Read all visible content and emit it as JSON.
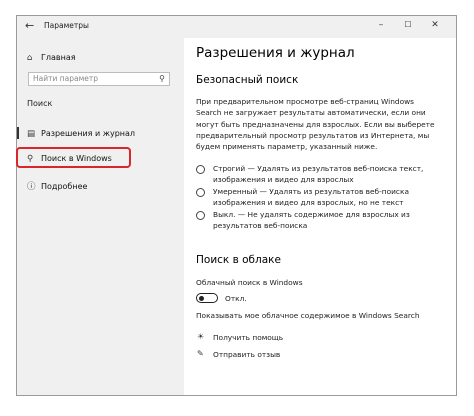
{
  "window": {
    "title": "Параметры"
  },
  "sidebar": {
    "home_label": "Главная",
    "search_placeholder": "Найти параметр",
    "section_title": "Поиск",
    "items": [
      {
        "label": "Разрешения и журнал",
        "icon": "history-list-icon"
      },
      {
        "label": "Поиск в Windows",
        "icon": "search-icon"
      },
      {
        "label": "Подробнее",
        "icon": "info-icon"
      }
    ]
  },
  "content": {
    "page_title": "Разрешения и журнал",
    "safe_search": {
      "heading": "Безопасный поиск",
      "description": "При предварительном просмотре веб-страниц Windows Search не загружает результаты автоматически, если они могут быть предназначены для взрослых. Если вы выберете предварительный просмотр результатов из Интернета, мы будем применять параметр, указанный ниже.",
      "options": [
        "Строгий — Удалять из результатов веб-поиска текст, изображения и видео для взрослых",
        "Умеренный — Удалять из результатов веб-поиска изображения и видео для взрослых, но не текст",
        "Выкл. — Не удалять содержимое для взрослых из результатов веб-поиска"
      ]
    },
    "cloud_search": {
      "heading": "Поиск в облаке",
      "label": "Облачный поиск в Windows",
      "toggle_state": "Откл.",
      "toggle_on": false,
      "show_content": "Показывать мое облачное содержимое в Windows Search"
    },
    "links": {
      "help": "Получить помощь",
      "feedback": "Отправить отзыв"
    }
  }
}
